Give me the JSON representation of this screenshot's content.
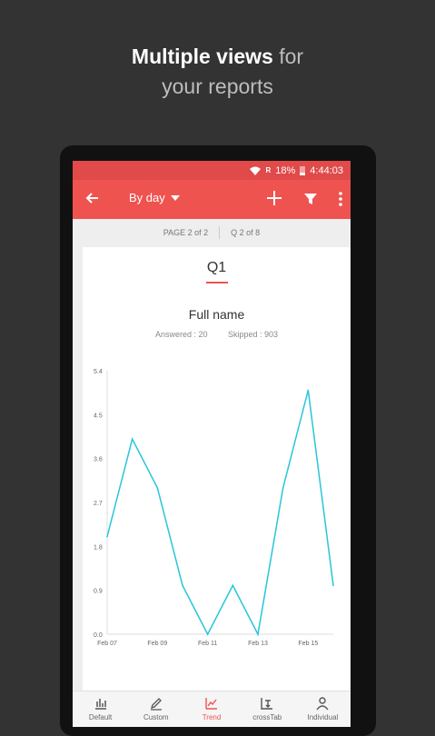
{
  "promo": {
    "bold": "Multiple views",
    "rest": " for",
    "line2": "your reports"
  },
  "status": {
    "signal": "R",
    "battery": "18%",
    "time": "4:44:03"
  },
  "appbar": {
    "title": "By day"
  },
  "pager": {
    "page": "PAGE 2 of 2",
    "question": "Q 2 of 8"
  },
  "card": {
    "q_title": "Q1",
    "field_name": "Full name",
    "answered": "Answered : 20",
    "skipped": "Skipped : 903"
  },
  "nav": [
    {
      "label": "Default",
      "icon": "bar-chart-icon",
      "active": false
    },
    {
      "label": "Custom",
      "icon": "edit-icon",
      "active": false
    },
    {
      "label": "Trend",
      "icon": "trend-icon",
      "active": true
    },
    {
      "label": "crossTab",
      "icon": "crosstab-icon",
      "active": false
    },
    {
      "label": "Individual",
      "icon": "person-icon",
      "active": false
    }
  ],
  "colors": {
    "accent": "#ef5350",
    "line": "#26c6da"
  },
  "chart_data": {
    "type": "line",
    "x": [
      0,
      1,
      2,
      3,
      4,
      5,
      6,
      7,
      8,
      9
    ],
    "xtick_labels": [
      "Feb 07",
      "Feb 09",
      "Feb 11",
      "Feb 13",
      "Feb 15"
    ],
    "xtick_positions": [
      0,
      2,
      4,
      6,
      8
    ],
    "values": [
      2.0,
      4.0,
      3.0,
      1.0,
      0.0,
      1.0,
      0.0,
      3.0,
      5.0,
      1.0
    ],
    "yticks": [
      "0.0",
      "0.9",
      "1.8",
      "2.7",
      "3.6",
      "4.5",
      "5.4"
    ],
    "ylim": [
      0,
      5.4
    ]
  }
}
